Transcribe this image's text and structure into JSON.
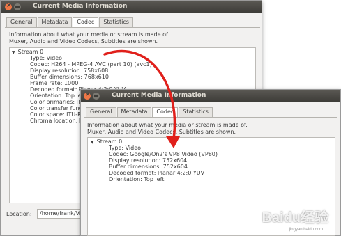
{
  "back_window": {
    "title": "Current Media Information",
    "tabs": [
      "General",
      "Metadata",
      "Codec",
      "Statistics"
    ],
    "active_tab": "Codec",
    "info_line1": "Information about what your media or stream is made of.",
    "info_line2": "Muxer, Audio and Video Codecs, Subtitles are shown.",
    "tree": [
      "Stream 0",
      "Type: Video",
      "Codec: H264 - MPEG-4 AVC (part 10) (avc1)",
      "Display resolution: 758x608",
      "Buffer dimensions: 768x610",
      "Frame rate: 1000",
      "Decoded format: Planar 4:2:0 YUV",
      "Orientation: Top left",
      "Color primaries: ITU-R BT.709",
      "Color transfer function",
      "Color space: ITU-R",
      "Chroma location: Left"
    ],
    "location_label": "Location:",
    "location_value": "/home/frank/Videos"
  },
  "front_window": {
    "title": "Current Media Information",
    "tabs": [
      "General",
      "Metadata",
      "Codec",
      "Statistics"
    ],
    "active_tab": "Codec",
    "info_line1": "Information about what your media or stream is made of.",
    "info_line2": "Muxer, Audio and Video Codecs, Subtitles are shown.",
    "tree": [
      "Stream 0",
      "Type: Video",
      "Codec: Google/On2's VP8 Video (VP80)",
      "Display resolution: 752x604",
      "Buffer dimensions: 752x604",
      "Decoded format: Planar 4:2:0 YUV",
      "Orientation: Top left"
    ]
  },
  "annotation": {
    "arrow_color": "#e0201b"
  },
  "watermark": {
    "text": "Baidu经验",
    "sub": "jingyan.baidu.com"
  }
}
